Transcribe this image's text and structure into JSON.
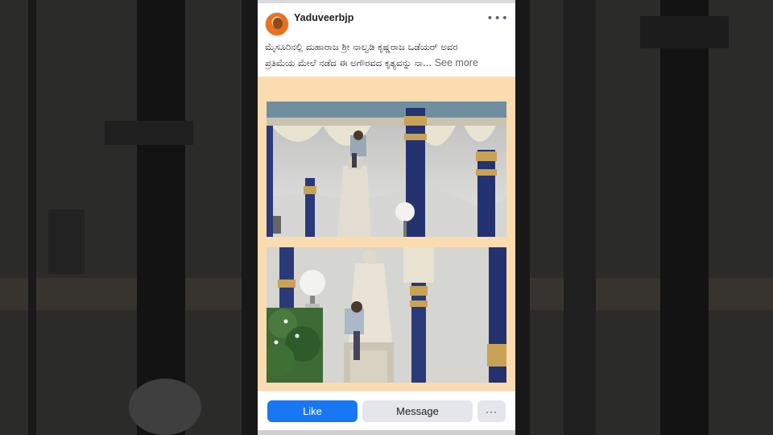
{
  "post": {
    "username": "Yaduveerbjp",
    "avatar_icon": "profile-avatar",
    "more_icon": "more-options-icon",
    "more_glyph": "•••",
    "caption_line1": "ಮೈಸೂರಿನಲ್ಲಿ ಮಹಾರಾಜ ಶ್ರೀ ನಾಲ್ವಡಿ ಕೃಷ್ಣರಾಜ ಒಡೆಯರ್ ಅವರ",
    "caption_line2": "ಪ್ರತಿಮೆಯ ಮೇಲೆ ನಡೆದ ಈ ಅಗೌರವದ ಕೃತ್ಯವನ್ನು ನಾ...",
    "see_more": "See more"
  },
  "actions": {
    "like_label": "Like",
    "message_label": "Message",
    "more_label": "···"
  },
  "colors": {
    "like_bg": "#1877f2",
    "media_bg": "#fbdcb0",
    "secondary_btn_bg": "#e4e6eb"
  }
}
